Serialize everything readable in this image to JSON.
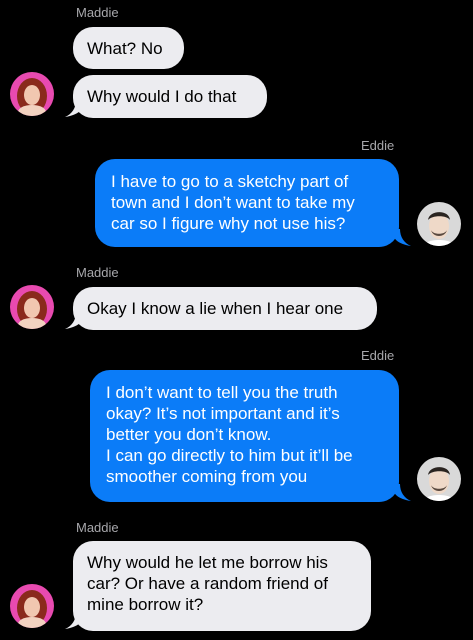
{
  "conversation": {
    "messages": [
      {
        "sender": "Maddie",
        "text": "What? No"
      },
      {
        "text": "Why would I do that"
      },
      {
        "sender": "Eddie",
        "text": "I have to go to a sketchy part of\ntown and I don’t want to take my\ncar so I figure why not use his?"
      },
      {
        "sender": "Maddie",
        "text": "Okay I know a lie when I hear one"
      },
      {
        "sender": "Eddie",
        "text": "I don’t want to tell you the truth\nokay? It’s not important and it’s\nbetter you don’t know.\nI can go directly to him but it’ll be\nsmoother coming from you"
      },
      {
        "sender": "Maddie",
        "text": "Why would he let me borrow his\ncar? Or have a random friend of\nmine borrow it?"
      }
    ]
  },
  "colors": {
    "background": "#000000",
    "incoming_bubble": "#ececf0",
    "outgoing_bubble": "#0b7cf8",
    "sender_label": "#a7a7ab"
  },
  "icons": {
    "maddie_avatar": "avatar-photo-red-hair",
    "eddie_avatar": "avatar-photo-dark-hair"
  }
}
